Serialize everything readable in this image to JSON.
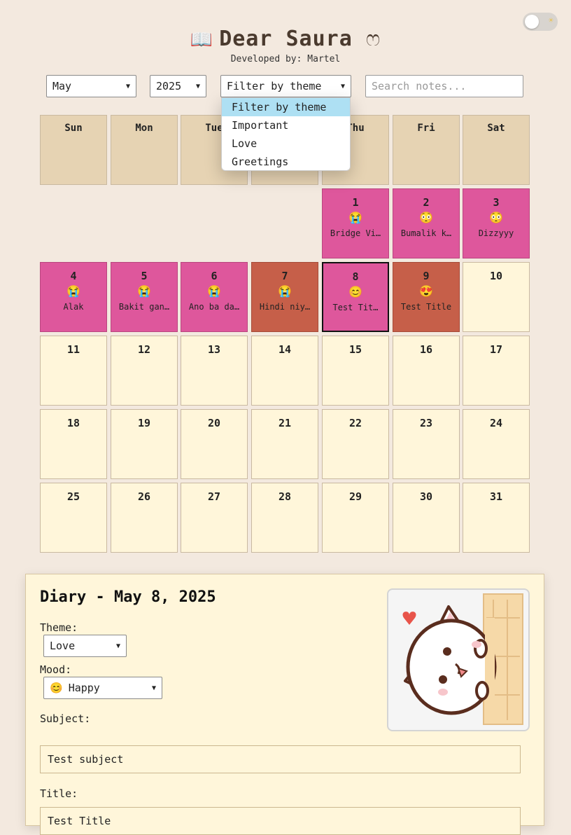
{
  "app": {
    "title": "Dear Saura",
    "subtitle": "Developed by: Martel",
    "book_icon": "📖",
    "heart_icon": "ෆ",
    "toggle_icon": "☀"
  },
  "controls": {
    "month": "May",
    "year": "2025",
    "theme_filter": "Filter by theme",
    "search_placeholder": "Search notes..."
  },
  "filter_dropdown": {
    "options": [
      "Filter by theme",
      "Important",
      "Love",
      "Greetings"
    ],
    "selected": "Filter by theme"
  },
  "weekdays": [
    "Sun",
    "Mon",
    "Tue",
    "Wed",
    "Thu",
    "Fri",
    "Sat"
  ],
  "calendar": {
    "month": "May",
    "year": 2025,
    "first_weekday": 4,
    "selected_day": 8,
    "colors": {
      "important": "#de579c",
      "love": "#c65f49",
      "empty": "#fff6da",
      "header": "#e6d3b3"
    },
    "entries": [
      {
        "day": "1",
        "emoji": "😭",
        "label": "Bridge Vi…",
        "theme": "pink"
      },
      {
        "day": "2",
        "emoji": "😳",
        "label": "Bumalik k…",
        "theme": "pink"
      },
      {
        "day": "3",
        "emoji": "😳",
        "label": "Dizzyyy",
        "theme": "pink"
      },
      {
        "day": "4",
        "emoji": "😭",
        "label": "Alak",
        "theme": "pink"
      },
      {
        "day": "5",
        "emoji": "😭",
        "label": "Bakit gan…",
        "theme": "pink"
      },
      {
        "day": "6",
        "emoji": "😭",
        "label": "Ano ba da…",
        "theme": "pink"
      },
      {
        "day": "7",
        "emoji": "😭",
        "label": "Hindi niy…",
        "theme": "red"
      },
      {
        "day": "8",
        "emoji": "😊",
        "label": "Test Tit…",
        "theme": "pink"
      },
      {
        "day": "9",
        "emoji": "😍",
        "label": "Test Title",
        "theme": "red"
      }
    ],
    "days_in_month": 31
  },
  "diary": {
    "heading": "Diary - May 8, 2025",
    "theme_label": "Theme:",
    "theme_value": "Love",
    "mood_label": "Mood:",
    "mood_emoji": "😊",
    "mood_value": "Happy",
    "subject_label": "Subject:",
    "subject_value": "Test subject",
    "title_label": "Title:",
    "title_value": "Test Title",
    "sticker_icon": "cat-peeking-sticker"
  }
}
